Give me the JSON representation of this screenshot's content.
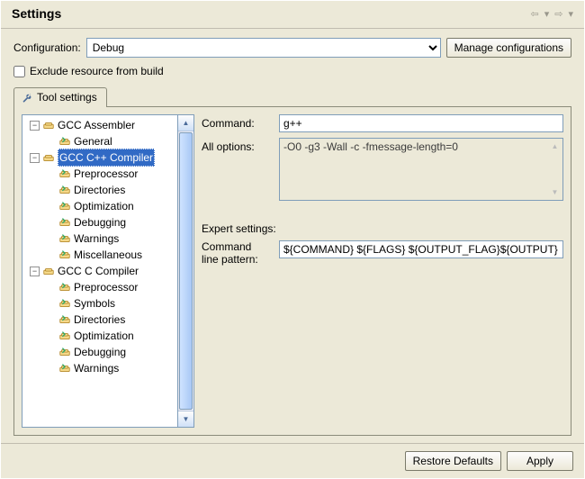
{
  "title": "Settings",
  "config": {
    "label": "Configuration:",
    "value": "Debug",
    "manage_label": "Manage configurations"
  },
  "exclude_label": "Exclude resource from build",
  "tab_label": "Tool settings",
  "tree": [
    {
      "indent": 0,
      "expander": "minus",
      "icon": "tool",
      "label": "GCC Assembler",
      "selected": false
    },
    {
      "indent": 1,
      "expander": "none",
      "icon": "cat",
      "label": "General",
      "selected": false
    },
    {
      "indent": 0,
      "expander": "minus",
      "icon": "tool",
      "label": "GCC C++ Compiler",
      "selected": true
    },
    {
      "indent": 1,
      "expander": "none",
      "icon": "cat",
      "label": "Preprocessor",
      "selected": false
    },
    {
      "indent": 1,
      "expander": "none",
      "icon": "cat",
      "label": "Directories",
      "selected": false
    },
    {
      "indent": 1,
      "expander": "none",
      "icon": "cat",
      "label": "Optimization",
      "selected": false
    },
    {
      "indent": 1,
      "expander": "none",
      "icon": "cat",
      "label": "Debugging",
      "selected": false
    },
    {
      "indent": 1,
      "expander": "none",
      "icon": "cat",
      "label": "Warnings",
      "selected": false
    },
    {
      "indent": 1,
      "expander": "none",
      "icon": "cat",
      "label": "Miscellaneous",
      "selected": false
    },
    {
      "indent": 0,
      "expander": "minus",
      "icon": "tool",
      "label": "GCC C Compiler",
      "selected": false
    },
    {
      "indent": 1,
      "expander": "none",
      "icon": "cat",
      "label": "Preprocessor",
      "selected": false
    },
    {
      "indent": 1,
      "expander": "none",
      "icon": "cat",
      "label": "Symbols",
      "selected": false
    },
    {
      "indent": 1,
      "expander": "none",
      "icon": "cat",
      "label": "Directories",
      "selected": false
    },
    {
      "indent": 1,
      "expander": "none",
      "icon": "cat",
      "label": "Optimization",
      "selected": false
    },
    {
      "indent": 1,
      "expander": "none",
      "icon": "cat",
      "label": "Debugging",
      "selected": false
    },
    {
      "indent": 1,
      "expander": "none",
      "icon": "cat",
      "label": "Warnings",
      "selected": false
    }
  ],
  "editor": {
    "command_label": "Command:",
    "command_value": "g++",
    "all_options_label": "All options:",
    "all_options_value": "-O0 -g3 -Wall -c -fmessage-length=0",
    "expert_label": "Expert settings:",
    "pattern_label1": "Command",
    "pattern_label2": "line pattern:",
    "pattern_value": "${COMMAND} ${FLAGS} ${OUTPUT_FLAG}${OUTPUT}"
  },
  "footer": {
    "restore": "Restore Defaults",
    "apply": "Apply"
  },
  "icons": {
    "tool": "tool-icon",
    "cat": "category-icon"
  }
}
